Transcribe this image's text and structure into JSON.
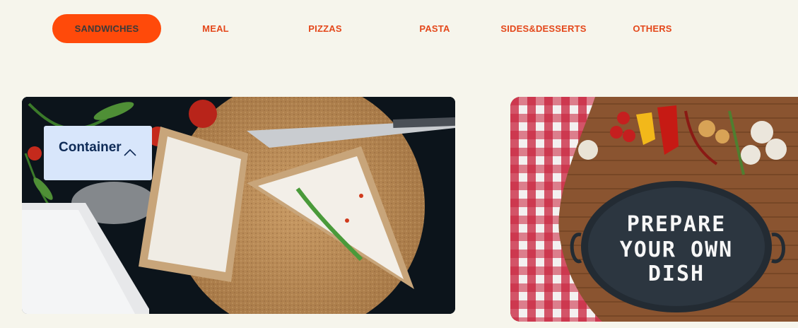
{
  "nav": {
    "items": [
      {
        "label": "SANDWICHES",
        "active": true
      },
      {
        "label": "MEAL",
        "active": false
      },
      {
        "label": "PIZZAS",
        "active": false
      },
      {
        "label": "PASTA",
        "active": false
      },
      {
        "label": "SIDES&DESSERTS",
        "active": false
      },
      {
        "label": "OTHERS",
        "active": false
      }
    ]
  },
  "colors": {
    "accent": "#ff4a0a",
    "nav_text": "#e4481b",
    "background": "#f6f5ec",
    "container_box": "#d8e6fb"
  },
  "tooltip": {
    "label": "Container",
    "icon": "chevron-up-icon"
  },
  "promo": {
    "line1": "PREPARE",
    "line2": "YOUR OWN",
    "line3": "DISH"
  },
  "images": {
    "left": "sandwich-photo",
    "right": "prepare-your-own-dish-photo"
  }
}
